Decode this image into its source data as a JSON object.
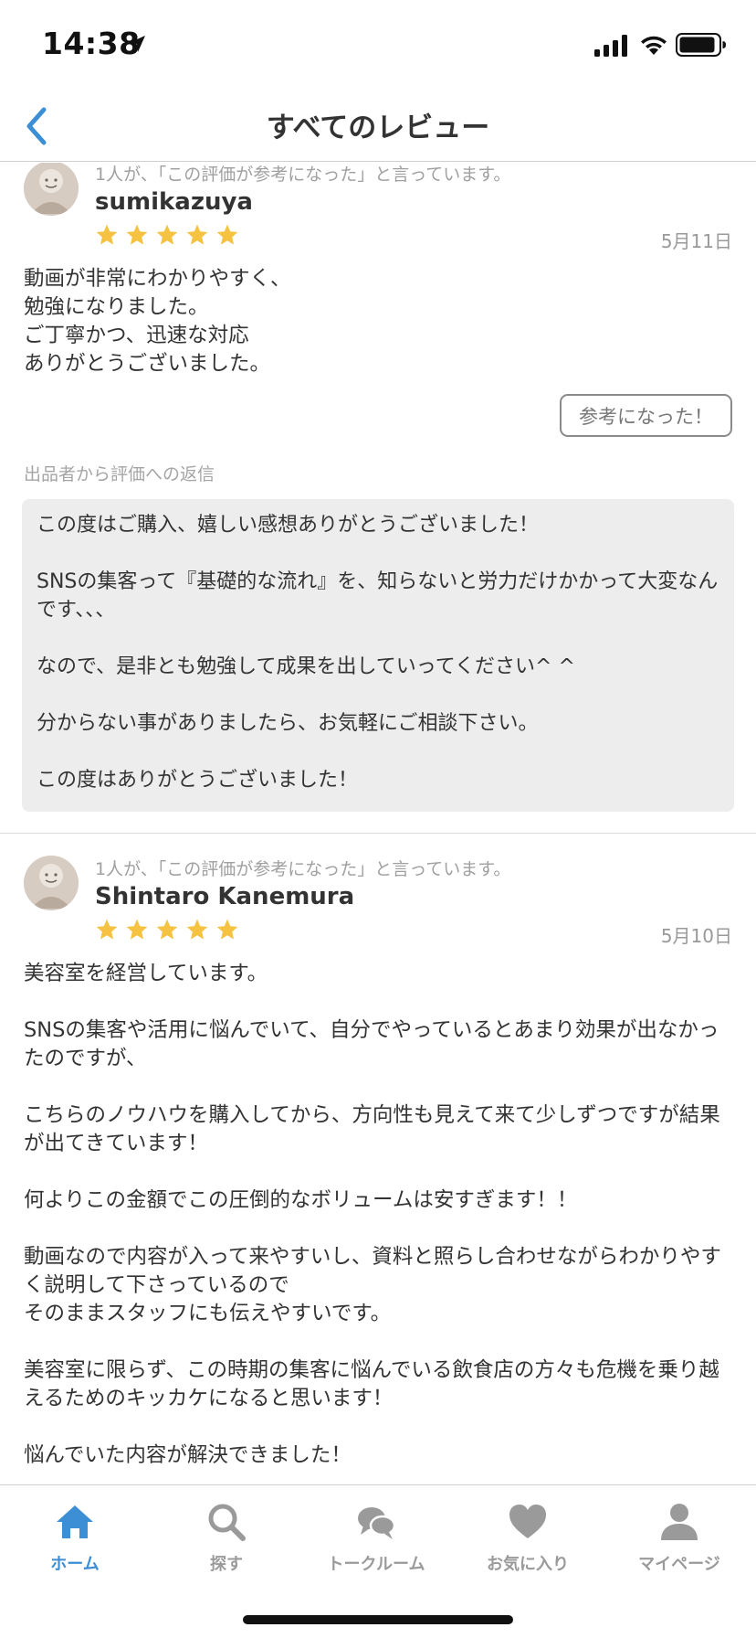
{
  "status_bar": {
    "time": "14:38"
  },
  "nav": {
    "title": "すべてのレビュー"
  },
  "colors": {
    "accent": "#3d8fd5",
    "star": "#f5c242",
    "inactive_tab": "#9a9a9a",
    "reply_bg": "#ededed"
  },
  "reviews": [
    {
      "helpful_note": "1人が、「この評価が参考になった」と言っています。",
      "name": "sumikazuya",
      "stars": 5,
      "date": "5月11日",
      "body": "動画が非常にわかりやすく、\n勉強になりました。\nご丁寧かつ、迅速な対応\nありがとうございました。",
      "helpful_button": "参考になった！",
      "reply_label": "出品者から評価への返信",
      "reply": "この度はご購入、嬉しい感想ありがとうございました！\n\nSNSの集客って『基礎的な流れ』を、知らないと労力だけかかって大変なんです、、、\n\nなので、是非とも勉強して成果を出していってください^ ^\n\n分からない事がありましたら、お気軽にご相談下さい。\n\nこの度はありがとうございました！"
    },
    {
      "helpful_note": "1人が、「この評価が参考になった」と言っています。",
      "name": "Shintaro Kanemura",
      "stars": 5,
      "date": "5月10日",
      "body": "美容室を経営しています。\n\nSNSの集客や活用に悩んでいて、自分でやっているとあまり効果が出なかったのですが、\n\nこちらのノウハウを購入してから、方向性も見えて来て少しずつですが結果が出てきています！\n\n何よりこの金額でこの圧倒的なボリュームは安すぎます！！\n\n動画なので内容が入って来やすいし、資料と照らし合わせながらわかりやすく説明して下さっているので\nそのままスタッフにも伝えやすいです。\n\n美容室に限らず、この時期の集客に悩んでいる飲食店の方々も危機を乗り越えるためのキッカケになると思います！\n\n悩んでいた内容が解決できました！"
    }
  ],
  "tabs": [
    {
      "label": "ホーム",
      "icon": "home-icon",
      "active": true
    },
    {
      "label": "探す",
      "icon": "search-icon",
      "active": false
    },
    {
      "label": "トークルーム",
      "icon": "chat-icon",
      "active": false
    },
    {
      "label": "お気に入り",
      "icon": "heart-icon",
      "active": false
    },
    {
      "label": "マイページ",
      "icon": "person-icon",
      "active": false
    }
  ]
}
